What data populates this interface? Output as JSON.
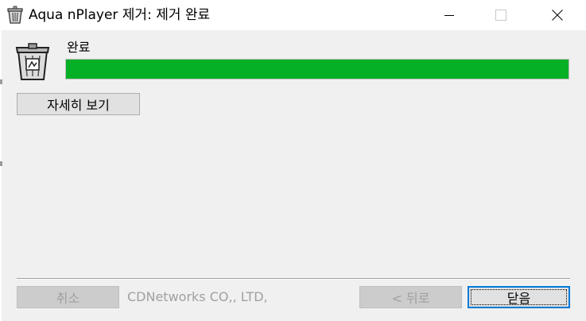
{
  "window": {
    "title": "Aqua nPlayer 제거: 제거 완료",
    "title_icon": "recycle-bin-icon",
    "controls": {
      "minimize_icon": "minimize-icon",
      "maximize_icon": "maximize-icon",
      "close_icon": "close-icon"
    }
  },
  "main": {
    "app_icon": "uninstall-bin-icon",
    "status_label": "완료",
    "progress_fraction": 1.0,
    "progress_color": "#06b025",
    "details_button_label": "자세히 보기"
  },
  "footer": {
    "cancel_label": "취소",
    "brand_text": "CDNetworks CO,, LTD,",
    "back_label": "< 뒤로",
    "close_label": "닫음"
  }
}
